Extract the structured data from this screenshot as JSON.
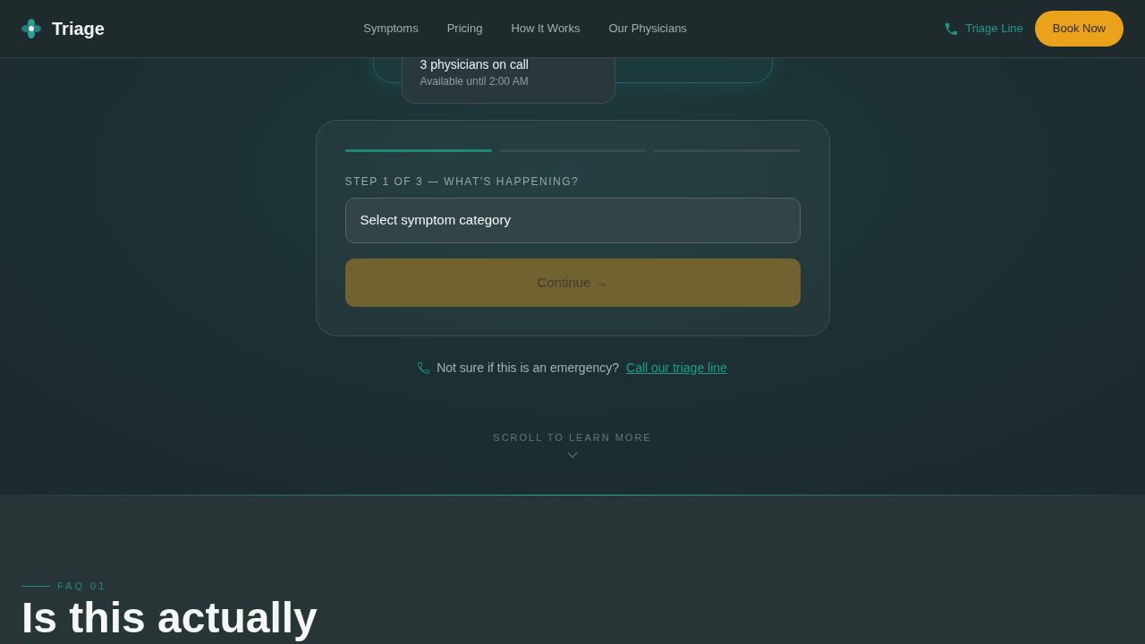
{
  "navbar": {
    "brand": "Triage",
    "links": [
      "Symptoms",
      "Pricing",
      "How It Works",
      "Our Physicians"
    ],
    "phone_link": "Triage Line",
    "cta": "Book Now"
  },
  "availability_card": {
    "title": "3 physicians on call",
    "subtitle": "Available until 2:00 AM"
  },
  "triage_form": {
    "steps": [
      {
        "active": true
      },
      {
        "active": false
      },
      {
        "active": false
      }
    ],
    "step_label": "STEP 1 OF 3 — WHAT'S HAPPENING?",
    "symptom_select": {
      "value": "Select symptom category"
    },
    "continue_button": {
      "label": "Continue →",
      "disabled": true
    }
  },
  "emergency_note": {
    "text": "Not sure if this is an emergency?",
    "link": "Call our triage line"
  },
  "scroll_hint": "SCROLL TO LEARN MORE",
  "faq": {
    "eyebrow": "FAQ 01",
    "heading": "Is this actually"
  }
}
